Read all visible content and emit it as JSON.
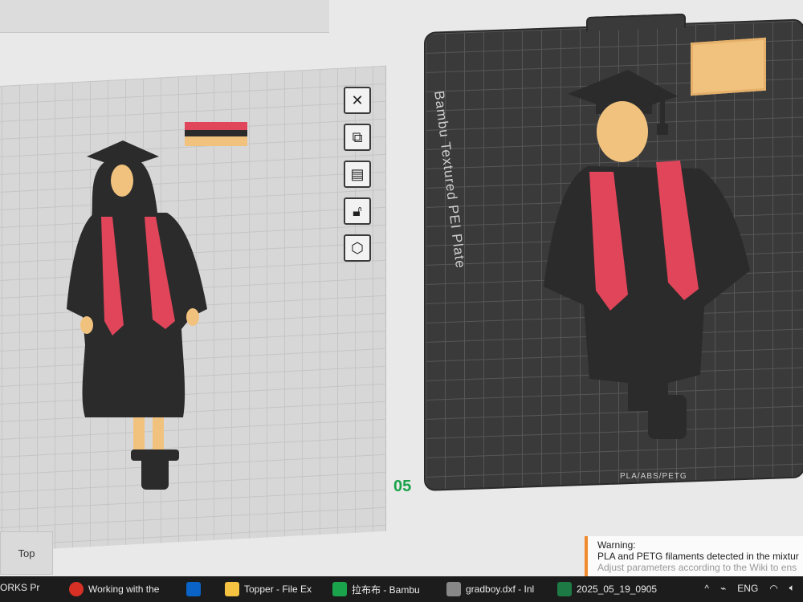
{
  "plates": {
    "left": {
      "number": "05"
    },
    "right": {
      "label": "Bambu Textured PEI Plate",
      "material": "PLA/ABS/PETG"
    }
  },
  "toolbar": {
    "buttons": [
      "close",
      "arrange",
      "orient",
      "lock",
      "settings"
    ]
  },
  "view": {
    "top_label": "Top"
  },
  "warning": {
    "title": "Warning:",
    "line1": "PLA and PETG filaments detected in the mixtur",
    "line2": "Adjust parameters according to the Wiki to ens"
  },
  "taskbar": {
    "items": [
      {
        "label": "ORKS Pr"
      },
      {
        "label": "Working with the"
      },
      {
        "label": "Topper - File Ex"
      },
      {
        "label": "拉布布 - Bambu"
      },
      {
        "label": "gradboy.dxf - Inl"
      },
      {
        "label": "2025_05_19_0905"
      }
    ],
    "tray_lang": "ENG"
  },
  "colors": {
    "gown": "#2b2b2b",
    "stole": "#e0455a",
    "skin": "#f1c27d",
    "plate_dark": "#3a3a3a",
    "plate_light": "#d7d7d7",
    "accent_green": "#1aa34a",
    "warning_orange": "#f08a2c"
  }
}
